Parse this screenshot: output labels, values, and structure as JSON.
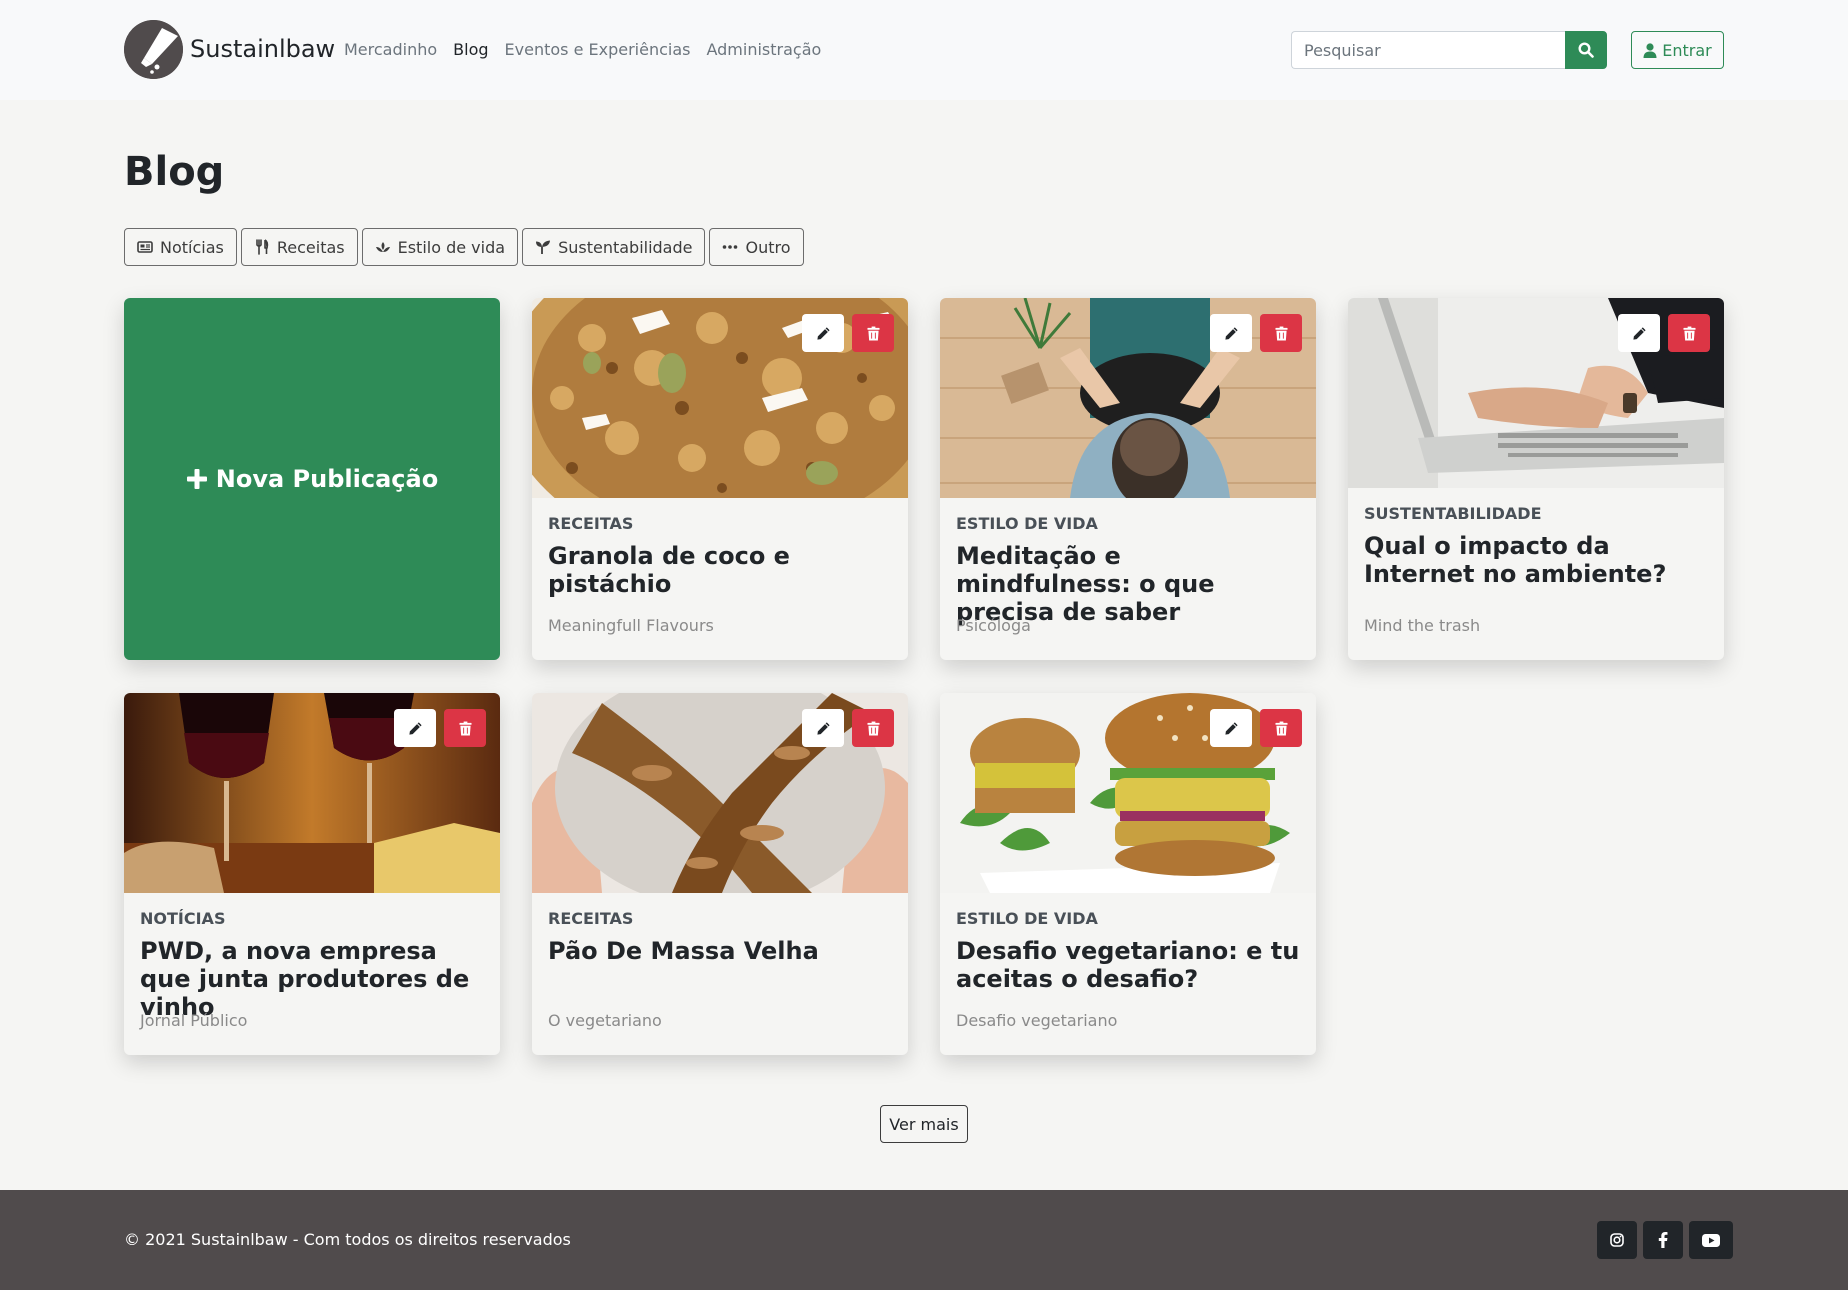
{
  "nav": {
    "brand": "Sustainlbaw",
    "links": [
      "Mercadinho",
      "Blog",
      "Eventos e Experiências",
      "Administração"
    ],
    "active_link": "Blog",
    "search_placeholder": "Pesquisar",
    "login_label": "Entrar"
  },
  "page": {
    "title": "Blog"
  },
  "filters": [
    {
      "label": "Notícias",
      "icon": "newspaper-icon"
    },
    {
      "label": "Receitas",
      "icon": "utensils-icon"
    },
    {
      "label": "Estilo de vida",
      "icon": "spa-lotus-icon"
    },
    {
      "label": "Sustentabilidade",
      "icon": "seedling-icon"
    },
    {
      "label": "Outro",
      "icon": "ellipsis-icon"
    }
  ],
  "new_post": {
    "label": "Nova Publicação"
  },
  "posts": [
    {
      "category": "Receitas",
      "title": "Granola de coco e pistáchio",
      "source": "Meaningfull Flavours"
    },
    {
      "category": "Estilo de vida",
      "title": "Meditação e mindfulness: o que precisa de saber",
      "source": "Psicóloga"
    },
    {
      "category": "Sustentabilidade",
      "title": "Qual o impacto da Internet no ambiente?",
      "source": "Mind the trash"
    },
    {
      "category": "Notícias",
      "title": "PWD, a nova empresa que junta produtores de vinho",
      "source": "Jornal Público"
    },
    {
      "category": "Receitas",
      "title": "Pão De Massa Velha",
      "source": "O vegetariano"
    },
    {
      "category": "Estilo de vida",
      "title": "Desafio vegetariano: e tu aceitas o desafio?",
      "source": "Desafio vegetariano"
    }
  ],
  "more_label": "Ver mais",
  "footer": {
    "copyright": "© 2021 Sustainlbaw - Com todos os direitos reservados",
    "socials": [
      "instagram-icon",
      "facebook-icon",
      "youtube-icon"
    ]
  },
  "colors": {
    "primary": "#2e8b57",
    "danger": "#dc3545",
    "footer_bg": "#504b4c",
    "page_bg": "#f5f5f3"
  }
}
